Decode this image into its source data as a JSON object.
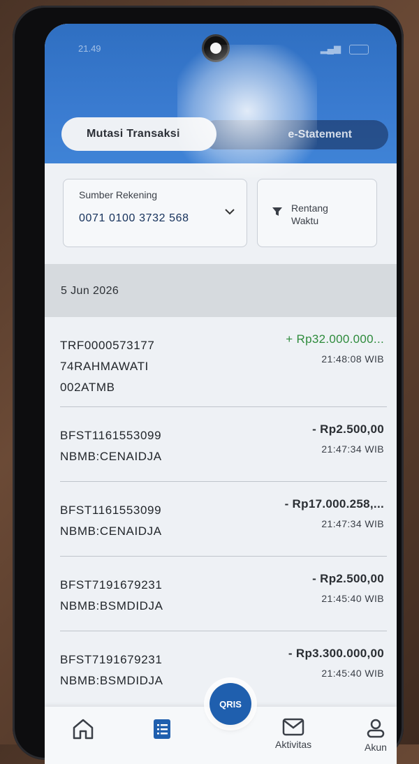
{
  "status_bar": {
    "time": "21.49"
  },
  "tabs": {
    "active": "Mutasi Transaksi",
    "inactive": "e-Statement"
  },
  "filters": {
    "account_label": "Sumber Rekening",
    "account_number": "0071 0100 3732 568",
    "range_label": "Rentang Waktu"
  },
  "date_header": "5 Jun 2026",
  "transactions": [
    {
      "desc": "TRF000057317774RAHMAWATI002ATMB",
      "desc_lines": [
        "TRF0000573177",
        "74RAHMAWATI",
        "002ATMB"
      ],
      "amount": "+ Rp32.000.000...",
      "time": "21:48:08 WIB",
      "type": "credit"
    },
    {
      "desc_lines": [
        "BFST1161553099",
        "NBMB:CENAIDJA"
      ],
      "amount": "- Rp2.500,00",
      "time": "21:47:34 WIB",
      "type": "debit"
    },
    {
      "desc_lines": [
        "BFST1161553099",
        "NBMB:CENAIDJA"
      ],
      "amount": "- Rp17.000.258,...",
      "time": "21:47:34 WIB",
      "type": "debit"
    },
    {
      "desc_lines": [
        "BFST7191679231",
        "NBMB:BSMDIDJA"
      ],
      "amount": "- Rp2.500,00",
      "time": "21:45:40 WIB",
      "type": "debit"
    },
    {
      "desc_lines": [
        "BFST7191679231",
        "NBMB:BSMDIDJA"
      ],
      "amount": "- Rp3.300.000,00",
      "time": "21:45:40 WIB",
      "type": "debit"
    }
  ],
  "bottom_nav": {
    "qris": "QRIS",
    "activity": "Aktivitas",
    "account": "Akun"
  },
  "colors": {
    "primary": "#2f6fc1",
    "credit": "#2e8b3c",
    "qris": "#1f5fae"
  }
}
